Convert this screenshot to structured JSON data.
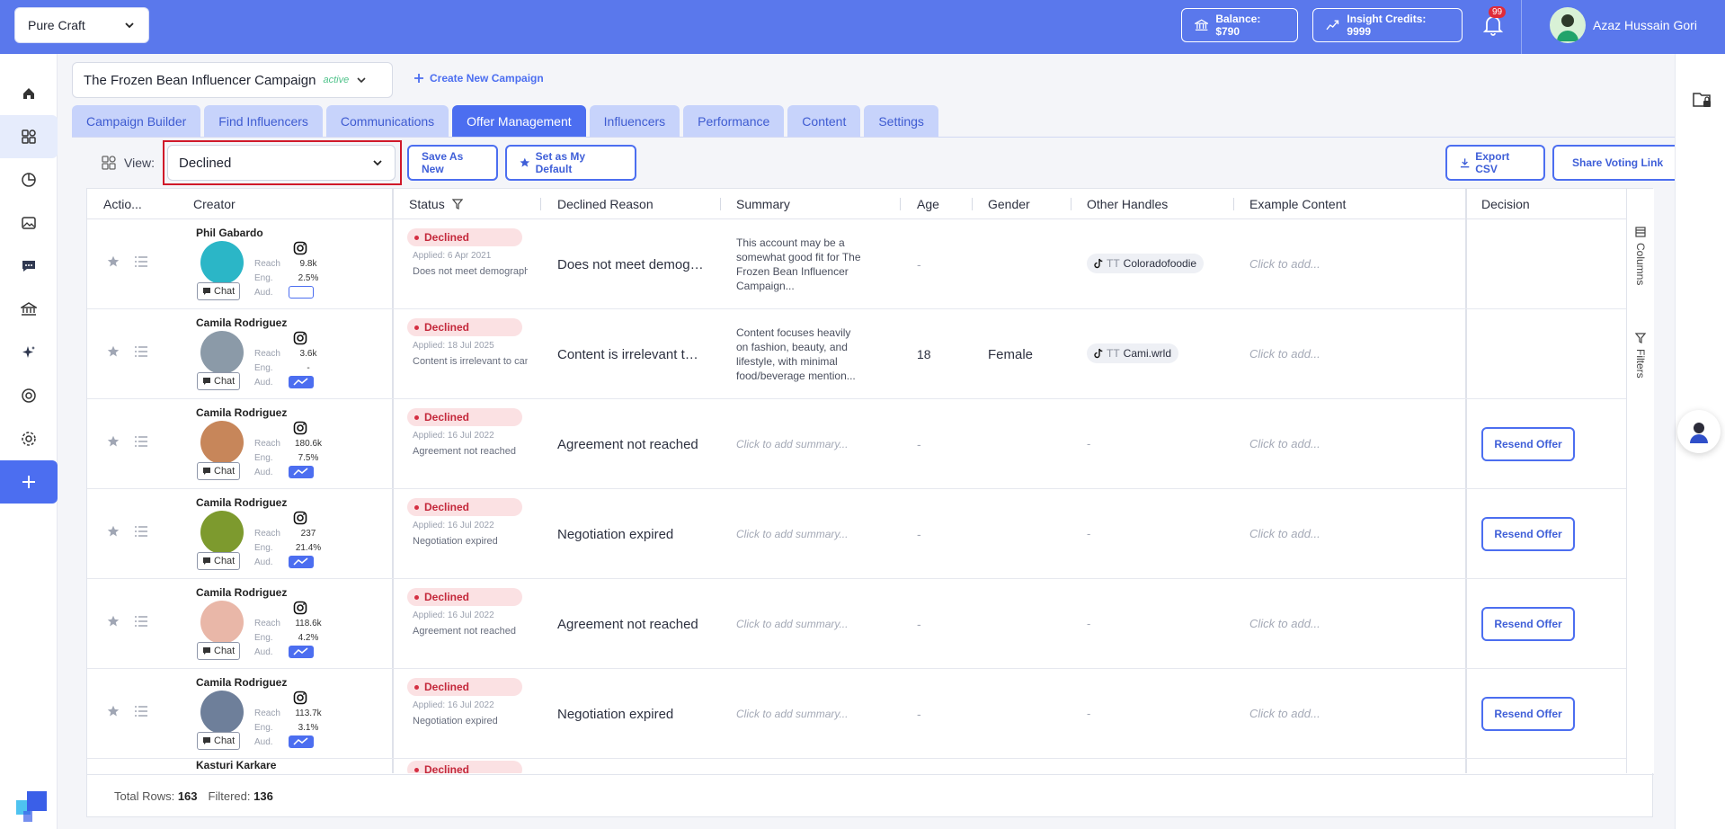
{
  "topbar": {
    "org": "Pure Craft",
    "balance": "Balance: $790",
    "insight_credits": "Insight Credits: 9999",
    "notification_count": "99",
    "user_name": "Azaz Hussain Gori"
  },
  "campaign": {
    "name": "The Frozen Bean Influencer Campaign",
    "status": "active",
    "create_label": "Create New Campaign"
  },
  "tabs": [
    "Campaign Builder",
    "Find Influencers",
    "Communications",
    "Offer Management",
    "Influencers",
    "Performance",
    "Content",
    "Settings"
  ],
  "active_tab": "Offer Management",
  "toolbar": {
    "view_label": "View:",
    "view_value": "Declined",
    "save_as_new": "Save As New",
    "set_default": "Set as My Default",
    "export_csv": "Export CSV",
    "share_voting": "Share Voting Link"
  },
  "columns": {
    "actions": "Actio...",
    "creator": "Creator",
    "status": "Status",
    "declined_reason": "Declined Reason",
    "summary": "Summary",
    "age": "Age",
    "gender": "Gender",
    "other_handles": "Other Handles",
    "example_content": "Example Content",
    "decision": "Decision"
  },
  "side_panel": {
    "columns": "Columns",
    "filters": "Filters"
  },
  "labels": {
    "reach": "Reach",
    "eng": "Eng.",
    "aud": "Aud.",
    "chat": "Chat",
    "status": "Declined",
    "example_placeholder": "Click to add...",
    "summary_placeholder": "Click to add summary...",
    "dash": "-",
    "resend": "Resend Offer",
    "tt": "TT"
  },
  "rows": [
    {
      "name": "Phil Gabardo",
      "reach": "9.8k",
      "eng": "2.5%",
      "applied": "Applied: 6 Apr 2021",
      "reason_short": "Does not meet demographic",
      "reason": "Does not meet demographic",
      "summary": "This account may be a somewhat good fit for The Frozen Bean Influencer Campaign...",
      "age": "-",
      "gender": "",
      "handle": "Coloradofoodie",
      "decision": "",
      "avatar_color": "#2bb6c7"
    },
    {
      "name": "Camila Rodriguez",
      "reach": "3.6k",
      "eng": "-",
      "applied": "Applied: 18 Jul 2025",
      "reason_short": "Content is irrelevant to campaign",
      "reason": "Content is irrelevant to campaign",
      "summary": "Content focuses heavily on fashion, beauty, and lifestyle, with minimal food/beverage mention...",
      "age": "18",
      "gender": "Female",
      "handle": "Cami.wrld",
      "decision": "",
      "avatar_color": "#8b9aa8"
    },
    {
      "name": "Camila Rodriguez",
      "reach": "180.6k",
      "eng": "7.5%",
      "applied": "Applied: 16 Jul 2022",
      "reason_short": "Agreement not reached",
      "reason": "Agreement not reached",
      "summary": "",
      "age": "-",
      "gender": "",
      "handle": "",
      "decision": "Resend Offer",
      "avatar_color": "#c7865a"
    },
    {
      "name": "Camila Rodriguez",
      "reach": "237",
      "eng": "21.4%",
      "applied": "Applied: 16 Jul 2022",
      "reason_short": "Negotiation expired",
      "reason": "Negotiation expired",
      "summary": "",
      "age": "-",
      "gender": "",
      "handle": "",
      "decision": "Resend Offer",
      "avatar_color": "#7d9a2e"
    },
    {
      "name": "Camila Rodriguez",
      "reach": "118.6k",
      "eng": "4.2%",
      "applied": "Applied: 16 Jul 2022",
      "reason_short": "Agreement not reached",
      "reason": "Agreement not reached",
      "summary": "",
      "age": "-",
      "gender": "",
      "handle": "",
      "decision": "Resend Offer",
      "avatar_color": "#e9b7a8"
    },
    {
      "name": "Camila Rodriguez",
      "reach": "113.7k",
      "eng": "3.1%",
      "applied": "Applied: 16 Jul 2022",
      "reason_short": "Negotiation expired",
      "reason": "Negotiation expired",
      "summary": "",
      "age": "-",
      "gender": "",
      "handle": "",
      "decision": "Resend Offer",
      "avatar_color": "#6e7f9a"
    }
  ],
  "partial_row_name": "Kasturi Karkare",
  "footer": {
    "total_label": "Total Rows:",
    "total": "163",
    "filtered_label": "Filtered:",
    "filtered": "136"
  }
}
